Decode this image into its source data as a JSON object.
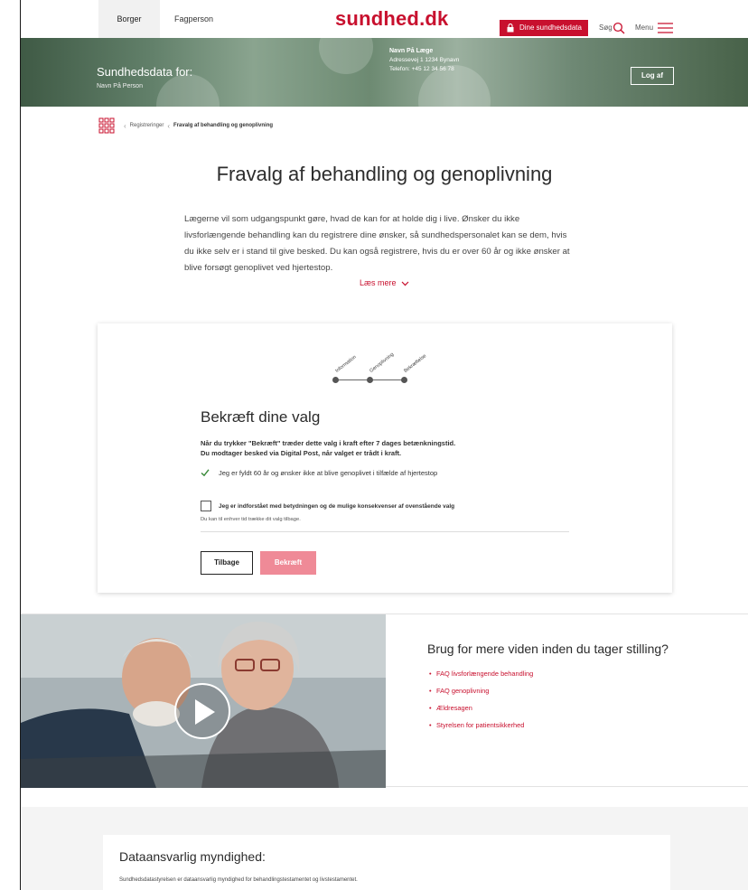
{
  "nav": {
    "tabs": [
      "Borger",
      "Fagperson"
    ],
    "logo": "sundhed.dk",
    "dine_label": "Dine sundhedsdata",
    "search_label": "Søg",
    "menu_label": "Menu",
    "accent": "#c8102e"
  },
  "hero": {
    "title": "Sundhedsdata for:",
    "person": "Navn På Person",
    "doctor_name": "Navn På Læge",
    "doctor_address": "Adressevej 1 1234 Bynavn",
    "doctor_phone": "Telefon: +45 12 34 56 78",
    "logout_label": "Log af"
  },
  "breadcrumb": {
    "parent": "Registreringer",
    "current": "Fravalg af behandling og genoplivning"
  },
  "page": {
    "title": "Fravalg af behandling og genoplivning",
    "intro": "Lægerne vil som udgangspunkt gøre, hvad de kan for at holde dig i live. Ønsker du ikke livsforlængende behandling kan du registrere dine ønsker, så sundhedspersonalet kan se dem, hvis du ikke selv er i stand til give besked. Du kan også registrere, hvis du er over 60 år og ikke ønsker at blive forsøgt genoplivet ved hjertestop.",
    "more_label": "Læs mere"
  },
  "card": {
    "steps": [
      "Information",
      "Genoplivning",
      "Bekræftelse"
    ],
    "title": "Bekræft dine valg",
    "text_line1": "Når du trykker \"Bekræft\" træder dette valg i kraft efter 7 dages betænkningstid.",
    "text_line2": "Du modtager besked via Digital Post, når valget er trådt i kraft.",
    "confirmed_choice": "Jeg er fyldt 60 år og ønsker ikke at blive genoplivet i tilfælde af hjertestop",
    "checkbox_label": "Jeg er indforstået med betydningen og de mulige konsekvenser af ovenstående valg",
    "checkbox_note": "Du kan til enhver tid trække dit valg tilbage.",
    "back_label": "Tilbage",
    "confirm_label": "Bekræft"
  },
  "media": {
    "title": "Brug for mere viden inden du tager stilling?",
    "links": [
      "FAQ livsforlængende behandling",
      "FAQ genoplivning",
      "Ældresagen",
      "Styrelsen for patientsikkerhed"
    ]
  },
  "footer": {
    "title": "Dataansvarlig myndighed:",
    "text": "Sundhedsdatastyrelsen er dataansvarlig myndighed for behandlingstestamentet og livstestamentet."
  }
}
